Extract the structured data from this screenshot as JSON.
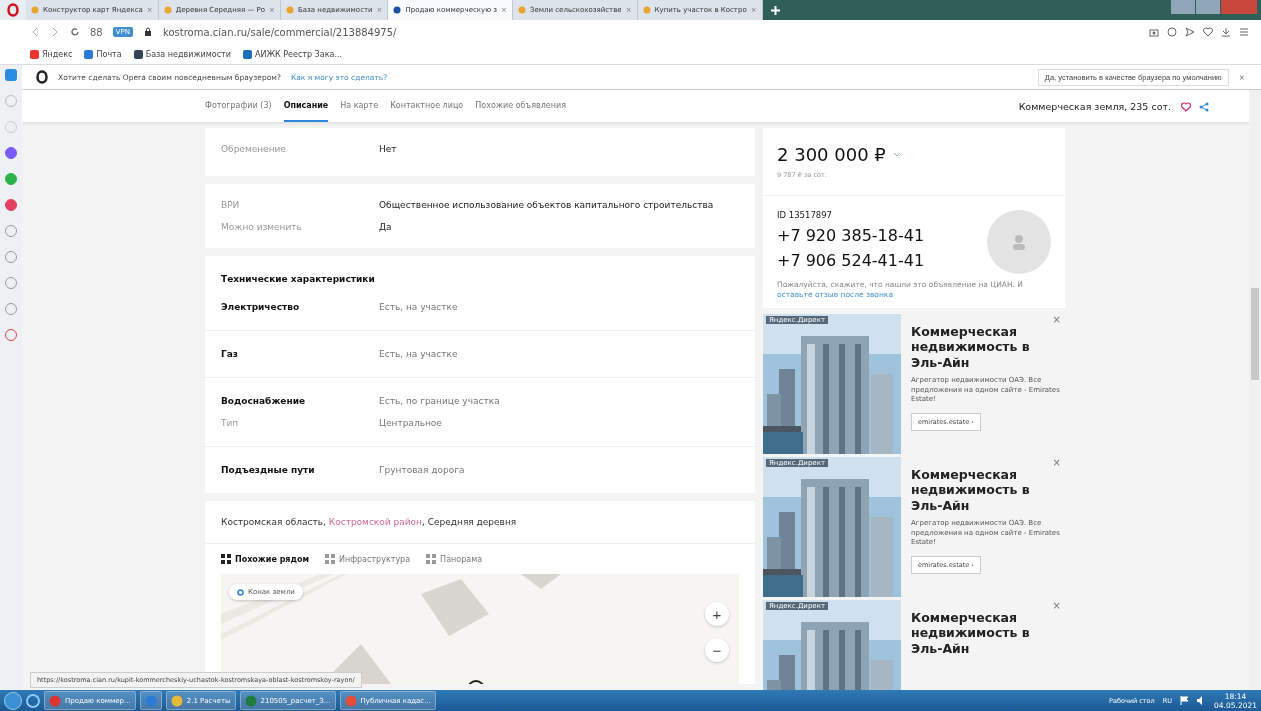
{
  "browser": {
    "tabs": [
      {
        "title": "Конструктор карт Яндекса",
        "selected": false,
        "close": "×"
      },
      {
        "title": "Деревня Середняя — Ро",
        "selected": false,
        "close": "×"
      },
      {
        "title": "База недвижимости",
        "selected": false,
        "close": "×"
      },
      {
        "title": "Продаю коммерческую з",
        "selected": true,
        "close": "×"
      },
      {
        "title": "Земли сельскохозяйстве",
        "selected": false,
        "close": "×"
      },
      {
        "title": "Купить участок в Костро",
        "selected": false,
        "close": "×"
      }
    ],
    "address": "kostroma.cian.ru/sale/commercial/213884975/",
    "speed_dial": "88",
    "vpn": "VPN",
    "bookmarks": [
      "Яндекс",
      "Почта",
      "База недвижимости",
      "АИЖК Реестр Зака..."
    ],
    "prompt": {
      "text": "Хотите сделать Opera своим повседневным браузером?",
      "link": "Как я могу это сделать?",
      "accept": "Да, установить в качестве браузера по умолчанию",
      "close": "×"
    }
  },
  "page": {
    "nav": {
      "tabs": [
        {
          "label": "Фотографии (3)",
          "selected": false
        },
        {
          "label": "Описание",
          "selected": true
        },
        {
          "label": "На карте",
          "selected": false
        },
        {
          "label": "Контактное лицо",
          "selected": false
        },
        {
          "label": "Похожие объявления",
          "selected": false
        }
      ],
      "title": "Коммерческая земля, 235 сот."
    },
    "details": [
      {
        "rows": [
          {
            "label": "Обременение",
            "value": "Нет",
            "kind": "plain"
          }
        ]
      },
      {
        "rows": [
          {
            "label": "ВРИ",
            "value": "Общественное использование объектов капитального строительства",
            "kind": "plain"
          },
          {
            "label": "Можно изменить",
            "value": "Да",
            "kind": "plain"
          }
        ]
      }
    ],
    "tech": {
      "heading": "Технические характеристики",
      "groups": [
        {
          "rows": [
            {
              "label": "Электричество",
              "value": "Есть, на участке",
              "kind": "main"
            }
          ]
        },
        {
          "rows": [
            {
              "label": "Газ",
              "value": "Есть, на участке",
              "kind": "main"
            }
          ]
        },
        {
          "rows": [
            {
              "label": "Водоснабжение",
              "value": "Есть, по границе участка",
              "kind": "main"
            },
            {
              "label": "Тип",
              "value": "Центральное",
              "kind": "sub"
            }
          ]
        },
        {
          "rows": [
            {
              "label": "Подъездные пути",
              "value": "Грунтовая дорога",
              "kind": "main"
            }
          ]
        }
      ]
    },
    "location": {
      "parts": [
        {
          "text": "Костромская область, ",
          "kind": "plain"
        },
        {
          "text": "Костромской район",
          "kind": "link"
        },
        {
          "text": ", Середняя деревня",
          "kind": "plain"
        }
      ],
      "map_tabs": [
        {
          "label": "Похожие рядом",
          "selected": true
        },
        {
          "label": "Инфраструктура",
          "selected": false
        },
        {
          "label": "Панорама",
          "selected": false
        }
      ],
      "map_chip": "Конак земли",
      "zoom_in": "+",
      "zoom_out": "−"
    },
    "offer": {
      "price": "2 300 000 ₽",
      "per_unit": "9 787 ₽ за сот.",
      "id": "ID 13517897",
      "phones": [
        "+7 920 385-18-41",
        "+7 906 524-41-41"
      ],
      "note": "Пожалуйста, скажите, что нашли это объявление на ЦИАН. И ",
      "note_link": "оставьте отзыв после звонка"
    },
    "ads": [
      {
        "label": "Яндекс.Директ",
        "title": "Коммерческая недвижимость в Эль-Айн",
        "text": "Агрегатор недвижимости ОАЭ. Все предложения на одном сайте - Emirates Estate!",
        "button": "emirates.estate ›",
        "close": "×"
      },
      {
        "label": "Яндекс.Директ",
        "title": "Коммерческая недвижимость в Эль-Айн",
        "text": "Агрегатор недвижимости ОАЭ. Все предложения на одном сайте - Emirates Estate!",
        "button": "emirates.estate ›",
        "close": "×"
      },
      {
        "label": "Яндекс.Директ",
        "title": "Коммерческая недвижимость в Эль-Айн",
        "close": "×"
      }
    ]
  },
  "status_url": "https://kostroma.cian.ru/kupit-kommercheskiy-uchastok-kostromskaya-oblast-kostromskoy-rayon/",
  "taskbar": {
    "items": [
      {
        "label": "Продаю коммер...",
        "kind": "opera"
      },
      {
        "kind": "app"
      },
      {
        "label": "2.1 Расчеты",
        "kind": "folder"
      },
      {
        "label": "210505_расчет_З...",
        "kind": "excel"
      },
      {
        "label": "Публичная кадас...",
        "kind": "chrome"
      }
    ],
    "desktop": "Рабочий стол",
    "lang": "RU",
    "time": "18:14",
    "date": "04.05.2021"
  }
}
